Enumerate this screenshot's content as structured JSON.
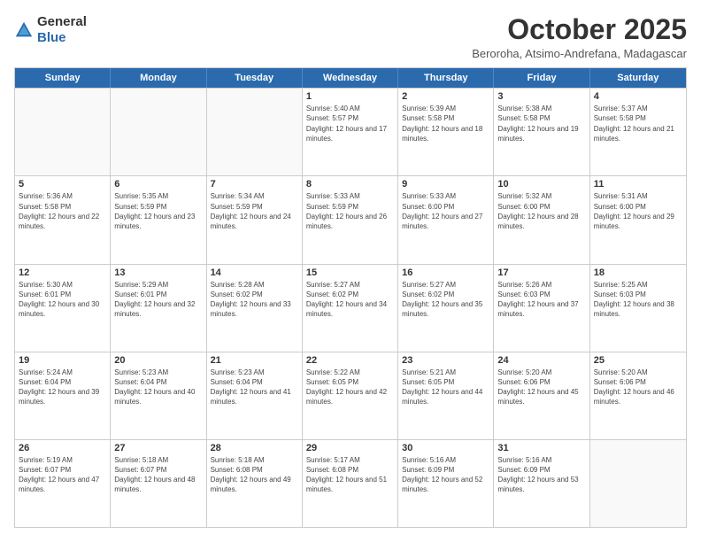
{
  "header": {
    "logo_general": "General",
    "logo_blue": "Blue",
    "title": "October 2025",
    "subtitle": "Beroroha, Atsimo-Andrefana, Madagascar"
  },
  "days_of_week": [
    "Sunday",
    "Monday",
    "Tuesday",
    "Wednesday",
    "Thursday",
    "Friday",
    "Saturday"
  ],
  "weeks": [
    [
      {
        "date": "",
        "sunrise": "",
        "sunset": "",
        "daylight": ""
      },
      {
        "date": "",
        "sunrise": "",
        "sunset": "",
        "daylight": ""
      },
      {
        "date": "",
        "sunrise": "",
        "sunset": "",
        "daylight": ""
      },
      {
        "date": "1",
        "sunrise": "Sunrise: 5:40 AM",
        "sunset": "Sunset: 5:57 PM",
        "daylight": "Daylight: 12 hours and 17 minutes."
      },
      {
        "date": "2",
        "sunrise": "Sunrise: 5:39 AM",
        "sunset": "Sunset: 5:58 PM",
        "daylight": "Daylight: 12 hours and 18 minutes."
      },
      {
        "date": "3",
        "sunrise": "Sunrise: 5:38 AM",
        "sunset": "Sunset: 5:58 PM",
        "daylight": "Daylight: 12 hours and 19 minutes."
      },
      {
        "date": "4",
        "sunrise": "Sunrise: 5:37 AM",
        "sunset": "Sunset: 5:58 PM",
        "daylight": "Daylight: 12 hours and 21 minutes."
      }
    ],
    [
      {
        "date": "5",
        "sunrise": "Sunrise: 5:36 AM",
        "sunset": "Sunset: 5:58 PM",
        "daylight": "Daylight: 12 hours and 22 minutes."
      },
      {
        "date": "6",
        "sunrise": "Sunrise: 5:35 AM",
        "sunset": "Sunset: 5:59 PM",
        "daylight": "Daylight: 12 hours and 23 minutes."
      },
      {
        "date": "7",
        "sunrise": "Sunrise: 5:34 AM",
        "sunset": "Sunset: 5:59 PM",
        "daylight": "Daylight: 12 hours and 24 minutes."
      },
      {
        "date": "8",
        "sunrise": "Sunrise: 5:33 AM",
        "sunset": "Sunset: 5:59 PM",
        "daylight": "Daylight: 12 hours and 26 minutes."
      },
      {
        "date": "9",
        "sunrise": "Sunrise: 5:33 AM",
        "sunset": "Sunset: 6:00 PM",
        "daylight": "Daylight: 12 hours and 27 minutes."
      },
      {
        "date": "10",
        "sunrise": "Sunrise: 5:32 AM",
        "sunset": "Sunset: 6:00 PM",
        "daylight": "Daylight: 12 hours and 28 minutes."
      },
      {
        "date": "11",
        "sunrise": "Sunrise: 5:31 AM",
        "sunset": "Sunset: 6:00 PM",
        "daylight": "Daylight: 12 hours and 29 minutes."
      }
    ],
    [
      {
        "date": "12",
        "sunrise": "Sunrise: 5:30 AM",
        "sunset": "Sunset: 6:01 PM",
        "daylight": "Daylight: 12 hours and 30 minutes."
      },
      {
        "date": "13",
        "sunrise": "Sunrise: 5:29 AM",
        "sunset": "Sunset: 6:01 PM",
        "daylight": "Daylight: 12 hours and 32 minutes."
      },
      {
        "date": "14",
        "sunrise": "Sunrise: 5:28 AM",
        "sunset": "Sunset: 6:02 PM",
        "daylight": "Daylight: 12 hours and 33 minutes."
      },
      {
        "date": "15",
        "sunrise": "Sunrise: 5:27 AM",
        "sunset": "Sunset: 6:02 PM",
        "daylight": "Daylight: 12 hours and 34 minutes."
      },
      {
        "date": "16",
        "sunrise": "Sunrise: 5:27 AM",
        "sunset": "Sunset: 6:02 PM",
        "daylight": "Daylight: 12 hours and 35 minutes."
      },
      {
        "date": "17",
        "sunrise": "Sunrise: 5:26 AM",
        "sunset": "Sunset: 6:03 PM",
        "daylight": "Daylight: 12 hours and 37 minutes."
      },
      {
        "date": "18",
        "sunrise": "Sunrise: 5:25 AM",
        "sunset": "Sunset: 6:03 PM",
        "daylight": "Daylight: 12 hours and 38 minutes."
      }
    ],
    [
      {
        "date": "19",
        "sunrise": "Sunrise: 5:24 AM",
        "sunset": "Sunset: 6:04 PM",
        "daylight": "Daylight: 12 hours and 39 minutes."
      },
      {
        "date": "20",
        "sunrise": "Sunrise: 5:23 AM",
        "sunset": "Sunset: 6:04 PM",
        "daylight": "Daylight: 12 hours and 40 minutes."
      },
      {
        "date": "21",
        "sunrise": "Sunrise: 5:23 AM",
        "sunset": "Sunset: 6:04 PM",
        "daylight": "Daylight: 12 hours and 41 minutes."
      },
      {
        "date": "22",
        "sunrise": "Sunrise: 5:22 AM",
        "sunset": "Sunset: 6:05 PM",
        "daylight": "Daylight: 12 hours and 42 minutes."
      },
      {
        "date": "23",
        "sunrise": "Sunrise: 5:21 AM",
        "sunset": "Sunset: 6:05 PM",
        "daylight": "Daylight: 12 hours and 44 minutes."
      },
      {
        "date": "24",
        "sunrise": "Sunrise: 5:20 AM",
        "sunset": "Sunset: 6:06 PM",
        "daylight": "Daylight: 12 hours and 45 minutes."
      },
      {
        "date": "25",
        "sunrise": "Sunrise: 5:20 AM",
        "sunset": "Sunset: 6:06 PM",
        "daylight": "Daylight: 12 hours and 46 minutes."
      }
    ],
    [
      {
        "date": "26",
        "sunrise": "Sunrise: 5:19 AM",
        "sunset": "Sunset: 6:07 PM",
        "daylight": "Daylight: 12 hours and 47 minutes."
      },
      {
        "date": "27",
        "sunrise": "Sunrise: 5:18 AM",
        "sunset": "Sunset: 6:07 PM",
        "daylight": "Daylight: 12 hours and 48 minutes."
      },
      {
        "date": "28",
        "sunrise": "Sunrise: 5:18 AM",
        "sunset": "Sunset: 6:08 PM",
        "daylight": "Daylight: 12 hours and 49 minutes."
      },
      {
        "date": "29",
        "sunrise": "Sunrise: 5:17 AM",
        "sunset": "Sunset: 6:08 PM",
        "daylight": "Daylight: 12 hours and 51 minutes."
      },
      {
        "date": "30",
        "sunrise": "Sunrise: 5:16 AM",
        "sunset": "Sunset: 6:09 PM",
        "daylight": "Daylight: 12 hours and 52 minutes."
      },
      {
        "date": "31",
        "sunrise": "Sunrise: 5:16 AM",
        "sunset": "Sunset: 6:09 PM",
        "daylight": "Daylight: 12 hours and 53 minutes."
      },
      {
        "date": "",
        "sunrise": "",
        "sunset": "",
        "daylight": ""
      }
    ]
  ]
}
